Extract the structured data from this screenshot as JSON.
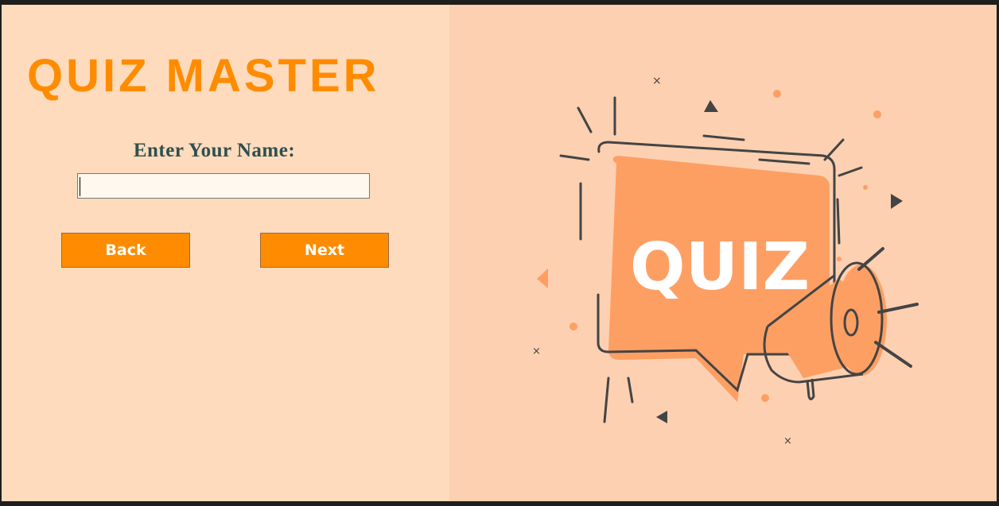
{
  "app": {
    "title": "QUIZ MASTER"
  },
  "form": {
    "name_label": "Enter Your Name:",
    "name_value": "",
    "back_label": "Back",
    "next_label": "Next"
  },
  "illustration": {
    "text": "QUIZ",
    "icons": [
      "speech-bubble-icon",
      "megaphone-icon"
    ]
  },
  "colors": {
    "accent": "#ff8c00",
    "left_bg": "#fedbbc",
    "right_bg": "#fdd0b1",
    "label": "#2f4f4f",
    "bubble": "#fd9f63"
  }
}
